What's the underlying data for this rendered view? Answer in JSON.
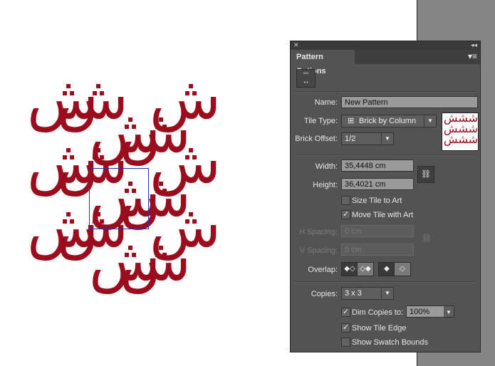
{
  "canvas": {
    "glyph": "ش",
    "glyph_color": "#9b0c1c",
    "tile_edge_color": "#2430c0"
  },
  "panel": {
    "title": "Pattern Options",
    "close_icon": "close-icon",
    "collapse_icon": "double-chevron-icon",
    "menu_icon": "panel-menu-icon",
    "tile_edit_icon": "pattern-tile-tool-icon",
    "name_label": "Name:",
    "name_value": "New Pattern",
    "tile_type_label": "Tile Type:",
    "tile_type_value": "Brick by Column",
    "brick_offset_label": "Brick Offset:",
    "brick_offset_value": "1/2",
    "width_label": "Width:",
    "width_value": "35,4448 cm",
    "height_label": "Height:",
    "height_value": "36,4021 cm",
    "size_tile_to_art": {
      "label": "Size Tile to Art",
      "checked": false
    },
    "move_tile_with_art": {
      "label": "Move Tile with Art",
      "checked": true
    },
    "h_spacing_label": "H Spacing:",
    "h_spacing_value": "0 cm",
    "v_spacing_label": "V Spacing:",
    "v_spacing_value": "0 cm",
    "overlap_label": "Overlap:",
    "copies_label": "Copies:",
    "copies_value": "3 x 3",
    "dim_copies": {
      "label": "Dim Copies to:",
      "checked": true,
      "value": "100%"
    },
    "show_tile_edge": {
      "label": "Show Tile Edge",
      "checked": true
    },
    "show_swatch_bounds": {
      "label": "Show Swatch Bounds",
      "checked": false
    }
  }
}
